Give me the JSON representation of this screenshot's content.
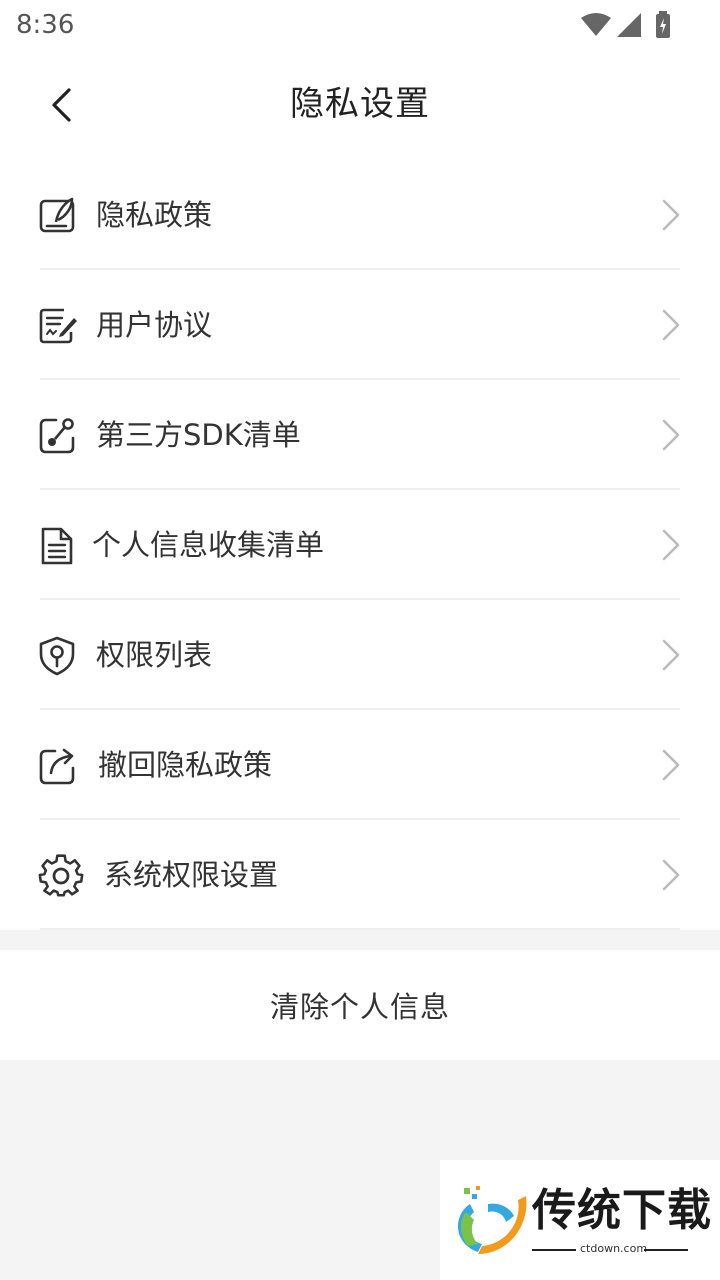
{
  "status_bar": {
    "time": "8:36",
    "icons": [
      "wifi-icon",
      "signal-icon",
      "battery-charging-icon"
    ]
  },
  "header": {
    "title": "隐私设置",
    "back_icon": "chevron-left-icon"
  },
  "menu": {
    "items": [
      {
        "label": "隐私政策",
        "icon": "document-signature-icon"
      },
      {
        "label": "用户协议",
        "icon": "agreement-edit-icon"
      },
      {
        "label": "第三方SDK清单",
        "icon": "share-link-icon"
      },
      {
        "label": "个人信息收集清单",
        "icon": "file-list-icon"
      },
      {
        "label": "权限列表",
        "icon": "shield-key-icon"
      },
      {
        "label": "撤回隐私政策",
        "icon": "revoke-share-icon"
      },
      {
        "label": "系统权限设置",
        "icon": "gear-icon"
      }
    ]
  },
  "actions": {
    "clear_label": "清除个人信息"
  },
  "watermark": {
    "title": "传统下载",
    "url": "ctdown.com"
  },
  "colors": {
    "background": "#f4f4f4",
    "surface": "#ffffff",
    "text": "#333333",
    "chevron": "#bbbbbb",
    "divider": "#f0f0f0"
  }
}
